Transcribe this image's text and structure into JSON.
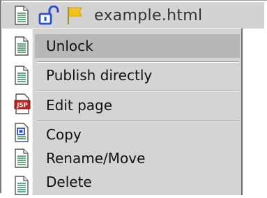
{
  "header": {
    "file_name": "example.html"
  },
  "icons": {
    "header": [
      "page-icon",
      "unlocked-icon",
      "flag-icon"
    ],
    "left_column": [
      "page-icon",
      "page-icon",
      "jsp-icon",
      "html-page-icon",
      "page-icon",
      "page-icon"
    ]
  },
  "left_column": {
    "jsp_label": "JSP"
  },
  "context_menu": {
    "items": [
      {
        "label": "Unlock"
      },
      {
        "label": "Publish directly"
      },
      {
        "label": "Edit page"
      },
      {
        "label": "Copy"
      },
      {
        "label": "Rename/Move"
      },
      {
        "label": "Delete"
      }
    ],
    "highlighted": "Unlock"
  },
  "colors": {
    "header_bg": "#d3d3d3",
    "menu_bg": "#d4d4d4",
    "highlight_bg": "#b7b7b7",
    "lock_blue": "#2a4fd0",
    "flag_yellow": "#f4c21a",
    "jsp_red": "#c0231f"
  }
}
